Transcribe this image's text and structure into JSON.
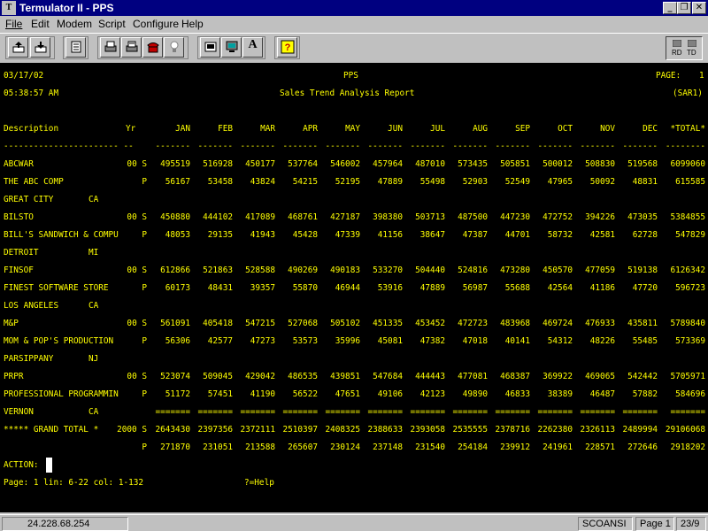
{
  "window": {
    "title": "Termulator II - PPS",
    "icon_label": "T"
  },
  "menu": [
    "File",
    "Edit",
    "Modem",
    "Script",
    "Configure",
    "Help"
  ],
  "toolbar_icons": [
    "send-file-icon",
    "receive-file-icon",
    "print-icon",
    "printer-setup-icon",
    "print-log-icon",
    "disconnect-phone-icon",
    "idea-icon",
    "terminal-settings-icon",
    "monitor-icon",
    "font-icon",
    "help-icon"
  ],
  "rdtd": {
    "rd": "RD",
    "td": "TD"
  },
  "screen": {
    "date": "03/17/02",
    "time": "05:38:57 AM",
    "system": "PPS",
    "report_title": "Sales Trend Analysis Report",
    "page_label": "PAGE:",
    "page_number": "1",
    "report_code": "(SAR1)",
    "headers": {
      "description": "Description",
      "yr": "Yr",
      "months": [
        "JAN",
        "FEB",
        "MAR",
        "APR",
        "MAY",
        "JUN",
        "JUL",
        "AUG",
        "SEP",
        "OCT",
        "NOV",
        "DEC",
        "*TOTAL*"
      ]
    },
    "rows": [
      {
        "desc": "ABCWAR",
        "yr": "00 S",
        "values": [
          "495519",
          "516928",
          "450177",
          "537764",
          "546002",
          "457964",
          "487010",
          "573435",
          "505851",
          "500012",
          "508830",
          "519568",
          "6099060"
        ]
      },
      {
        "desc": "THE ABC COMP",
        "yr": "P",
        "values": [
          "56167",
          "53458",
          "43824",
          "54215",
          "52195",
          "47889",
          "55498",
          "52903",
          "52549",
          "47965",
          "50092",
          "48831",
          "615585"
        ]
      },
      {
        "desc": "GREAT CITY       CA",
        "yr": "",
        "values": []
      },
      {
        "desc": "BILSTO",
        "yr": "00 S",
        "values": [
          "450880",
          "444102",
          "417089",
          "468761",
          "427187",
          "398380",
          "503713",
          "487500",
          "447230",
          "472752",
          "394226",
          "473035",
          "5384855"
        ]
      },
      {
        "desc": "BILL'S SANDWICH & COMPU",
        "yr": "P",
        "values": [
          "48053",
          "29135",
          "41943",
          "45428",
          "47339",
          "41156",
          "38647",
          "47387",
          "44701",
          "58732",
          "42581",
          "62728",
          "547829"
        ]
      },
      {
        "desc": "DETROIT          MI",
        "yr": "",
        "values": []
      },
      {
        "desc": "FINSOF",
        "yr": "00 S",
        "values": [
          "612866",
          "521863",
          "528588",
          "490269",
          "490183",
          "533270",
          "504440",
          "524816",
          "473280",
          "450570",
          "477059",
          "519138",
          "6126342"
        ]
      },
      {
        "desc": "FINEST SOFTWARE STORE",
        "yr": "P",
        "values": [
          "60173",
          "48431",
          "39357",
          "55870",
          "46944",
          "53916",
          "47889",
          "56987",
          "55688",
          "42564",
          "41186",
          "47720",
          "596723"
        ]
      },
      {
        "desc": "LOS ANGELES      CA",
        "yr": "",
        "values": []
      },
      {
        "desc": "M&P",
        "yr": "00 S",
        "values": [
          "561091",
          "405418",
          "547215",
          "527068",
          "505102",
          "451335",
          "453452",
          "472723",
          "483968",
          "469724",
          "476933",
          "435811",
          "5789840"
        ]
      },
      {
        "desc": "MOM & POP'S PRODUCTION",
        "yr": "P",
        "values": [
          "56306",
          "42577",
          "47273",
          "53573",
          "35996",
          "45081",
          "47382",
          "47018",
          "40141",
          "54312",
          "48226",
          "55485",
          "573369"
        ]
      },
      {
        "desc": "PARSIPPANY       NJ",
        "yr": "",
        "values": []
      },
      {
        "desc": "PRPR",
        "yr": "00 S",
        "values": [
          "523074",
          "509045",
          "429042",
          "486535",
          "439851",
          "547684",
          "444443",
          "477081",
          "468387",
          "369922",
          "469065",
          "542442",
          "5705971"
        ]
      },
      {
        "desc": "PROFESSIONAL PROGRAMMIN",
        "yr": "P",
        "values": [
          "51172",
          "57451",
          "41190",
          "56522",
          "47651",
          "49106",
          "42123",
          "49890",
          "46833",
          "38389",
          "46487",
          "57882",
          "584696"
        ]
      },
      {
        "desc": "VERNON           CA",
        "yr": "",
        "values": [
          "=======",
          "=======",
          "=======",
          "=======",
          "=======",
          "=======",
          "=======",
          "=======",
          "=======",
          "=======",
          "=======",
          "=======",
          "======="
        ]
      },
      {
        "desc": "***** GRAND TOTAL *",
        "yr": "2000 S",
        "values": [
          "2643430",
          "2397356",
          "2372111",
          "2510397",
          "2408325",
          "2388633",
          "2393058",
          "2535555",
          "2378716",
          "2262380",
          "2326113",
          "2489994",
          "29106068"
        ]
      },
      {
        "desc": "",
        "yr": "P",
        "values": [
          "271870",
          "231051",
          "213588",
          "265607",
          "230124",
          "237148",
          "231540",
          "254184",
          "239912",
          "241961",
          "228571",
          "272646",
          "2918202"
        ]
      }
    ],
    "action_label": "ACTION:",
    "status_line": "Page: 1 lin: 6-22 col: 1-132",
    "help_hint": "?=Help"
  },
  "statusbar": {
    "ip": "24.228.68.254",
    "emulation": "SCOANSI",
    "page": "Page 1",
    "position": "23/9"
  },
  "colors": {
    "screen_bg": "#000000",
    "screen_text": "#ffff00",
    "title_bg": "#000080",
    "chrome": "#c0c0c0"
  }
}
